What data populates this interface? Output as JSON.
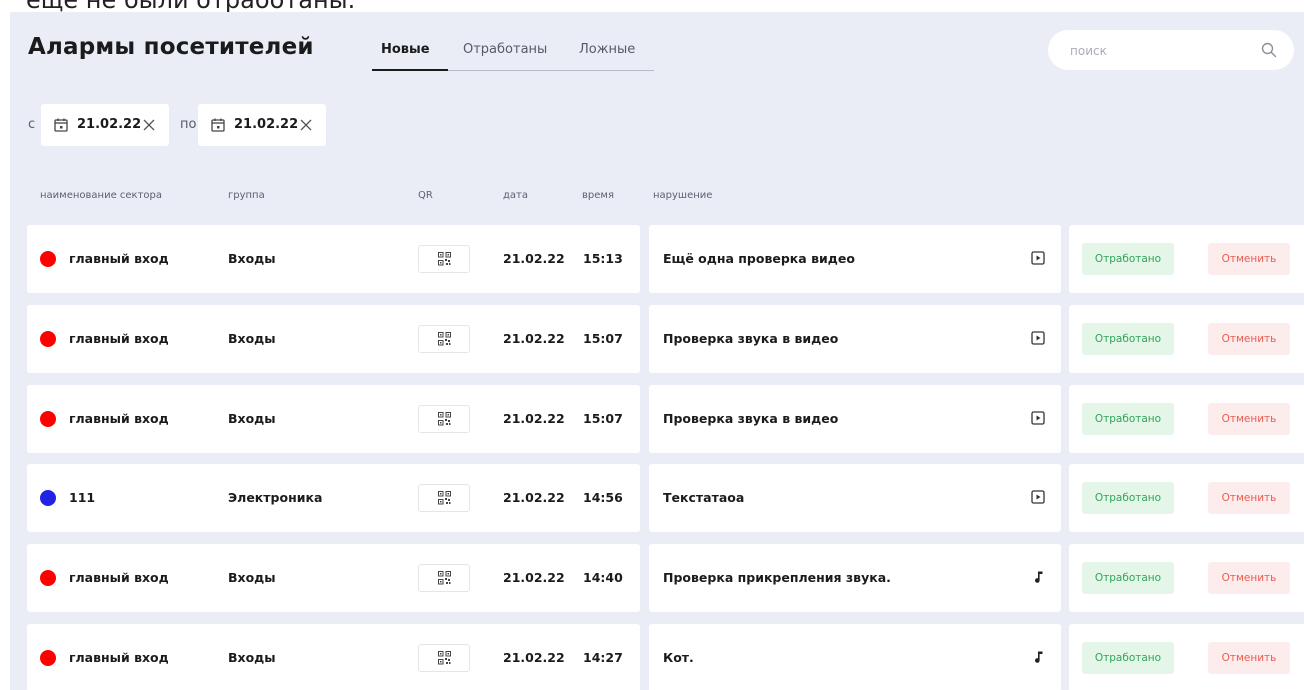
{
  "top_caption": "ещё не были отработаны.",
  "header": {
    "title": "Алармы посетителей",
    "tabs": [
      {
        "label": "Новые",
        "active": true
      },
      {
        "label": "Отработаны",
        "active": false
      },
      {
        "label": "Ложные",
        "active": false
      }
    ]
  },
  "search": {
    "placeholder": "поиск",
    "value": "",
    "icon": "search-icon"
  },
  "date_filter": {
    "from_prefix": "с",
    "to_prefix": "по",
    "from_value": "21.02.22",
    "to_value": "21.02.22",
    "calendar_icon": "calendar-icon",
    "clear_icon": "close-icon"
  },
  "columns": {
    "sector": "наименование сектора",
    "group": "группа",
    "qr": "QR",
    "date": "дата",
    "time": "время",
    "violation": "нарушение"
  },
  "actions": {
    "done_label": "Отработано",
    "cancel_label": "Отменить"
  },
  "colors": {
    "panel_bg": "#eaedf6",
    "status_red": "#ff0000",
    "status_blue": "#2323e6",
    "done_text": "#33a45b",
    "done_bg": "#e3f6e8",
    "cancel_text": "#ec5b4f",
    "cancel_bg": "#fdecec"
  },
  "rows": [
    {
      "status_color": "#ff0000",
      "sector": "главный вход",
      "group": "Входы",
      "date": "21.02.22",
      "time": "15:13",
      "violation": "Ещё одна проверка видео",
      "media": "video"
    },
    {
      "status_color": "#ff0000",
      "sector": "главный вход",
      "group": "Входы",
      "date": "21.02.22",
      "time": "15:07",
      "violation": "Проверка звука в видео",
      "media": "video"
    },
    {
      "status_color": "#ff0000",
      "sector": "главный вход",
      "group": "Входы",
      "date": "21.02.22",
      "time": "15:07",
      "violation": "Проверка звука в видео",
      "media": "video"
    },
    {
      "status_color": "#2323e6",
      "sector": "111",
      "group": "Электроника",
      "date": "21.02.22",
      "time": "14:56",
      "violation": "Текстатаоа",
      "media": "video"
    },
    {
      "status_color": "#ff0000",
      "sector": "главный вход",
      "group": "Входы",
      "date": "21.02.22",
      "time": "14:40",
      "violation": "Проверка прикрепления звука.",
      "media": "audio"
    },
    {
      "status_color": "#ff0000",
      "sector": "главный вход",
      "group": "Входы",
      "date": "21.02.22",
      "time": "14:27",
      "violation": "Кот.",
      "media": "audio"
    }
  ]
}
